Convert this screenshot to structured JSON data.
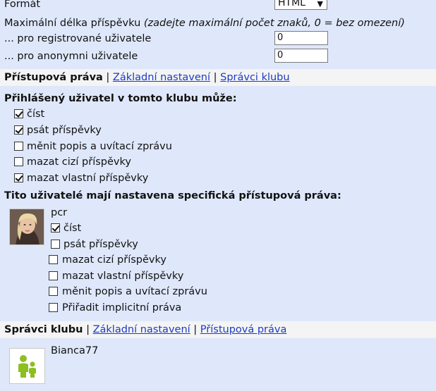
{
  "format": {
    "label": "Formát",
    "selected": "HTML"
  },
  "max_length": {
    "label": "Maximální délka příspěvku",
    "hint": "(zadejte maximální počet znaků, 0 = bez omezení)",
    "registered_label": "... pro registrované uživatele",
    "registered_value": "0",
    "anonymous_label": "... pro anonymni uživatele",
    "anonymous_value": "0"
  },
  "tabs_access": {
    "active": "Přístupová práva",
    "sep1": "|",
    "link1": "Základní nastavení",
    "sep2": "|",
    "link2": "Správci klubu"
  },
  "logged_user": {
    "heading": "Přihlášený uživatel v tomto klubu může:",
    "permissions": [
      {
        "label": "číst",
        "checked": true
      },
      {
        "label": "psát příspěvky",
        "checked": true
      },
      {
        "label": "měnit popis a uvítací zprávu",
        "checked": false
      },
      {
        "label": "mazat cizí příspěvky",
        "checked": false
      },
      {
        "label": "mazat vlastní příspěvky",
        "checked": true
      }
    ]
  },
  "specific_users": {
    "heading": "Tito uživatelé mají nastavena specifická přístupová práva:",
    "user": {
      "name": "pcr",
      "permissions": [
        {
          "label": "číst",
          "checked": true
        },
        {
          "label": "psát příspěvky",
          "checked": false
        },
        {
          "label": "mazat cizí příspěvky",
          "checked": false
        },
        {
          "label": "mazat vlastní příspěvky",
          "checked": false
        },
        {
          "label": "měnit popis a uvítací zprávu",
          "checked": false
        },
        {
          "label": "Přiřadit implicitní práva",
          "checked": false
        }
      ]
    }
  },
  "tabs_admins": {
    "active": "Správci klubu",
    "sep1": "|",
    "link1": "Základní nastavení",
    "sep2": "|",
    "link2": "Přístupová práva"
  },
  "admins": [
    {
      "name": "Bianca77"
    }
  ],
  "colors": {
    "background": "#dfe8fb",
    "tab_bar": "#f4f4f4",
    "link": "#1a3cc8",
    "avatar_icon": "#8cbf1f"
  }
}
